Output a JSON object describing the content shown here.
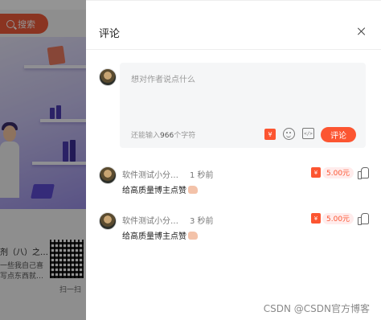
{
  "background_page": {
    "search_label": "搜索",
    "article_title": "剂（八）之…",
    "article_desc_line1": "一些我自己喜",
    "article_desc_line2": "写点东西就…",
    "qr_label": "扫一扫"
  },
  "drawer": {
    "title": "评论",
    "close_icon": "close-icon",
    "editor": {
      "placeholder": "想对作者说点什么",
      "counter_prefix": "还能输入",
      "counter_value": "966",
      "counter_suffix": "个字符",
      "rmb_symbol": "¥",
      "submit_label": "评论"
    },
    "comments": [
      {
        "user": "软件测试小分…",
        "time": "1 秒前",
        "text": "给高质量博主点赞",
        "reward": "5.00元",
        "reward_icon": "¥"
      },
      {
        "user": "软件测试小分…",
        "time": "3 秒前",
        "text": "给高质量博主点赞",
        "reward": "5.00元",
        "reward_icon": "¥"
      }
    ]
  },
  "watermark": "CSDN @CSDN官方博客",
  "colors": {
    "accent": "#fc5531",
    "overlay": "rgba(0,0,0,0.42)",
    "editor_bg": "#f5f6f7"
  }
}
